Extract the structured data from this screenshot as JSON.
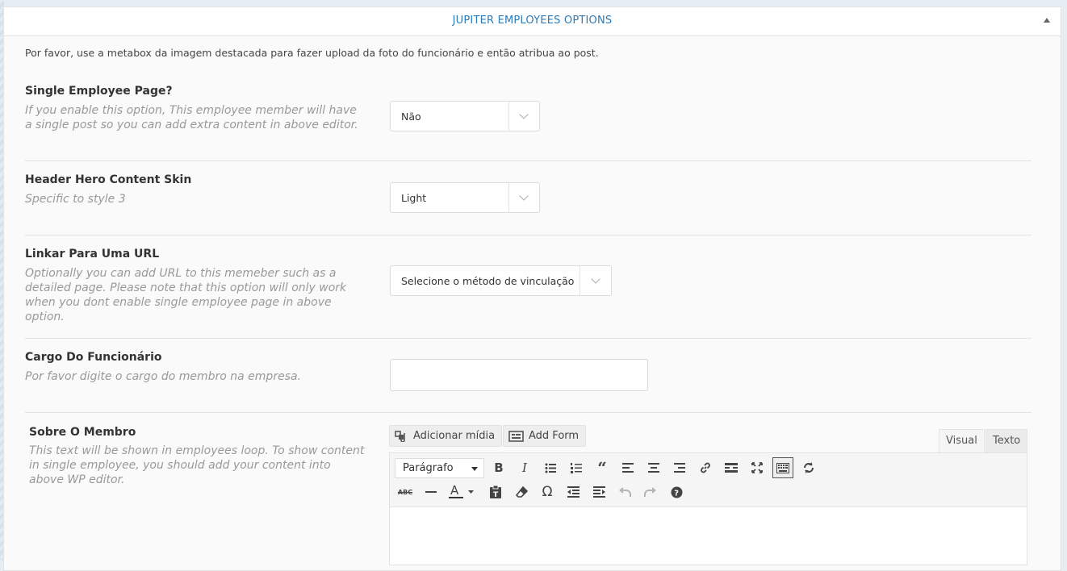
{
  "metabox": {
    "title": "JUPITER EMPLOYEES OPTIONS"
  },
  "intro": "Por favor, use a metabox da imagem destacada para fazer upload da foto do funcionário e então atribua ao post.",
  "fields": {
    "single_page": {
      "label": "Single Employee Page?",
      "desc": "If you enable this option, This employee member will have a single post so you can add extra content in above editor.",
      "value": "Não"
    },
    "hero_skin": {
      "label": "Header Hero Content Skin",
      "desc": "Specific to style 3",
      "value": "Light"
    },
    "link_url": {
      "label": "Linkar Para Uma URL",
      "desc": "Optionally you can add URL to this memeber such as a detailed page. Please note that this option will only work when you dont enable single employee page in above option.",
      "value": "Selecione o método de vinculação"
    },
    "position": {
      "label": "Cargo Do Funcionário",
      "desc": "Por favor digite o cargo do membro na empresa.",
      "value": ""
    },
    "about": {
      "label": "Sobre O Membro",
      "desc": "This text will be shown in employees loop. To show content in single employee, you should add your content into above WP editor."
    }
  },
  "editor": {
    "add_media": "Adicionar mídia",
    "add_form": "Add Form",
    "tab_visual": "Visual",
    "tab_text": "Texto",
    "format": "Parágrafo",
    "toolbar_row1": [
      "bold-icon",
      "italic-icon",
      "bullet-list-icon",
      "numbered-list-icon",
      "blockquote-icon",
      "align-left-icon",
      "align-center-icon",
      "align-right-icon",
      "link-icon",
      "read-more-icon",
      "fullscreen-icon",
      "toolbar-toggle-icon",
      "refresh-icon"
    ],
    "toolbar_row2": [
      "strikethrough-icon",
      "horizontal-line-icon",
      "text-color-icon",
      "paste-text-icon",
      "clear-formatting-icon",
      "special-character-icon",
      "outdent-icon",
      "indent-icon",
      "undo-icon",
      "redo-icon",
      "help-icon"
    ]
  }
}
